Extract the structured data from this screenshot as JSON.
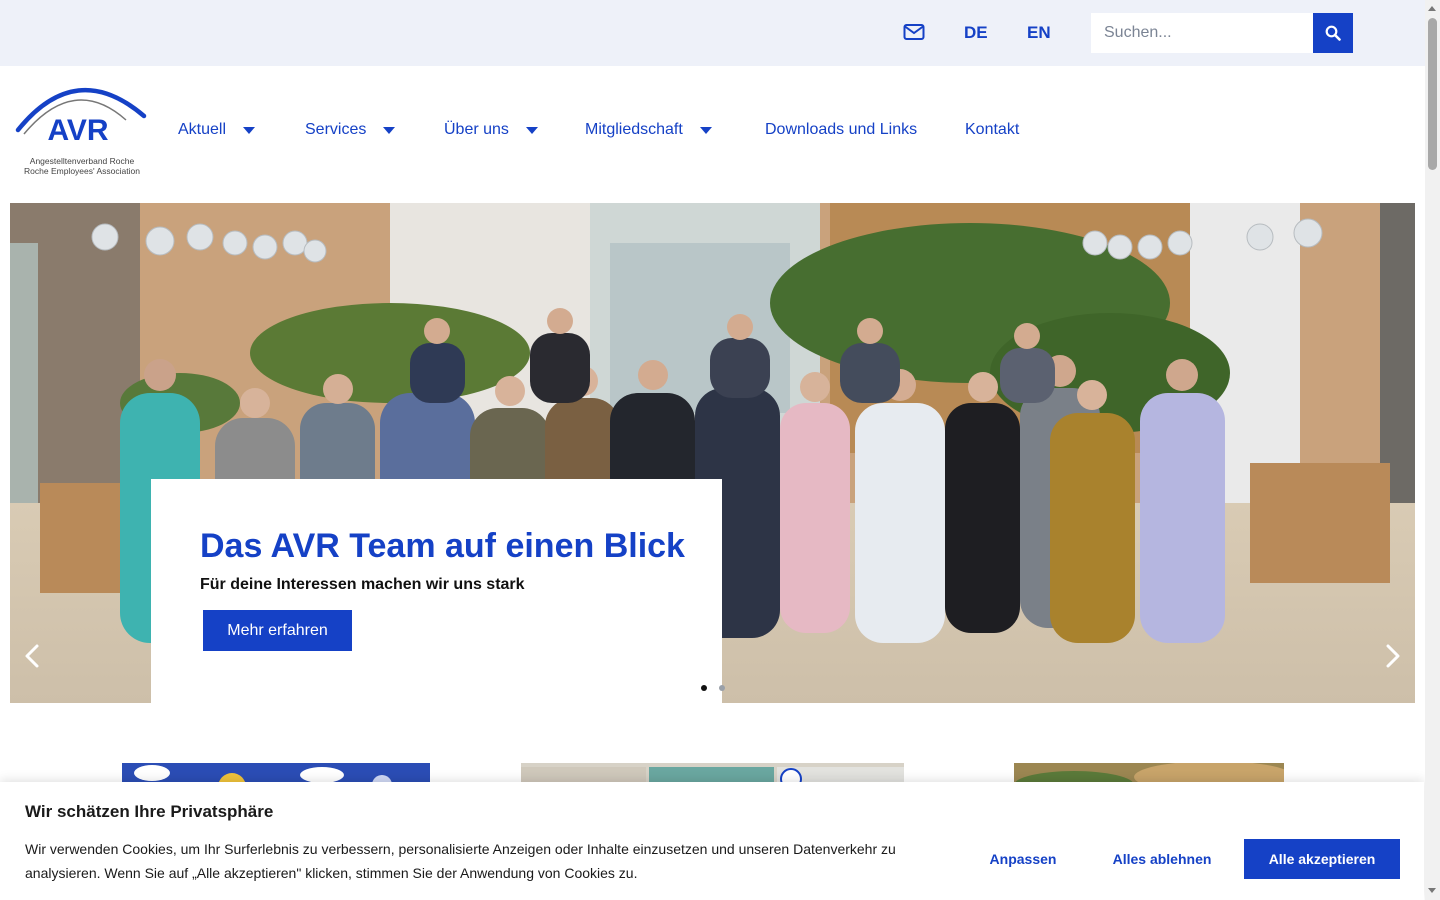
{
  "topbar": {
    "icons": {
      "mail": "mail-icon",
      "search": "search-icon"
    },
    "languages": [
      "DE",
      "EN"
    ],
    "search": {
      "placeholder": "Suchen...",
      "value": ""
    }
  },
  "logo": {
    "text": "AVR",
    "line1": "Angestelltenverband Roche",
    "line2": "Roche Employees' Association"
  },
  "nav": {
    "items": [
      {
        "label": "Aktuell",
        "has_dropdown": true
      },
      {
        "label": "Services",
        "has_dropdown": true
      },
      {
        "label": "Über uns",
        "has_dropdown": true
      },
      {
        "label": "Mitgliedschaft",
        "has_dropdown": true
      },
      {
        "label": "Downloads und Links",
        "has_dropdown": false
      },
      {
        "label": "Kontakt",
        "has_dropdown": false
      }
    ]
  },
  "hero": {
    "title": "Das AVR Team auf einen Blick",
    "subtitle": "Für deine Interessen machen wir uns stark",
    "button": "Mehr erfahren",
    "slides": {
      "count": 2,
      "active": 1
    },
    "icons": {
      "prev": "chevron-left-icon",
      "next": "chevron-right-icon"
    }
  },
  "cookie_banner": {
    "title": "Wir schätzen Ihre Privatsphäre",
    "text": "Wir verwenden Cookies, um Ihr Surferlebnis zu verbessern, personalisierte Anzeigen oder Inhalte einzusetzen und unseren Datenverkehr zu analysieren. Wenn Sie auf „Alle akzeptieren\" klicken, stimmen Sie der Anwendung von Cookies zu.",
    "buttons": {
      "customize": "Anpassen",
      "reject": "Alles ablehnen",
      "accept": "Alle akzeptieren"
    }
  },
  "colors": {
    "brand": "#1541c6",
    "topbar_bg": "#eef1f9"
  }
}
